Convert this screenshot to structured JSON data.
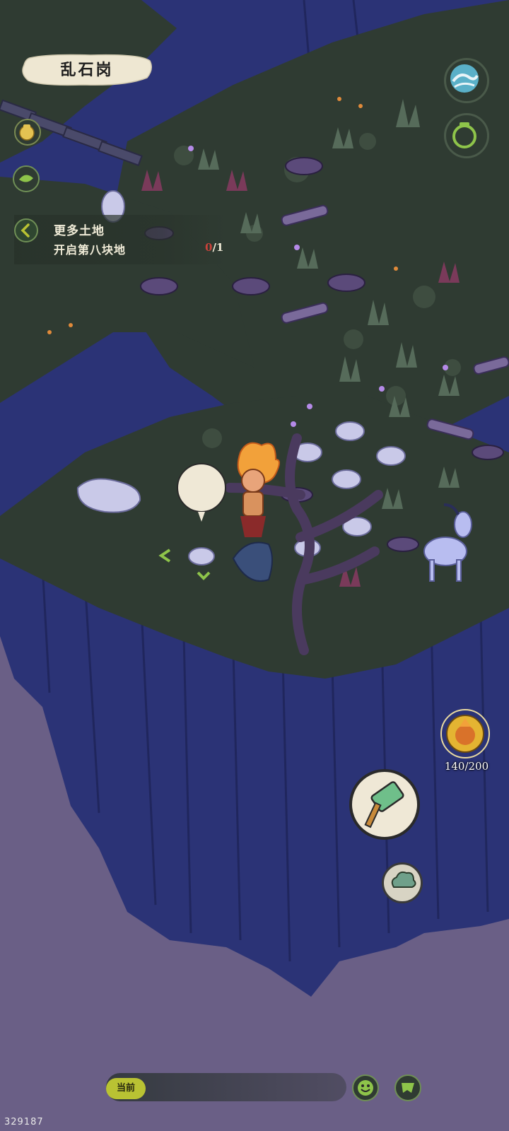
{
  "location": {
    "name": "乱石岗"
  },
  "quest": {
    "title": "更多土地",
    "subtitle": "开启第八块地",
    "progress_current": "0",
    "progress_total": "/1"
  },
  "energy": {
    "value": "140/200"
  },
  "bottom_bar": {
    "current_label": "当前"
  },
  "build_id": "329187",
  "icons": {
    "top_right_1": "wave-icon",
    "top_right_2": "jar-icon",
    "left_1": "coin-pot-icon",
    "left_2": "leaf-icon",
    "quest_back": "chevron-left-icon",
    "action": "hammer-icon",
    "cloud": "cloud-icon",
    "smile": "smile-icon",
    "chat": "chat-icon",
    "resource_bubble": "stone-icon"
  },
  "colors": {
    "cliff": "#2b3376",
    "grass": "#2f3b32",
    "sky": "#6a5f86",
    "accent_green": "#b9c233",
    "progress_red": "#c9423a"
  }
}
